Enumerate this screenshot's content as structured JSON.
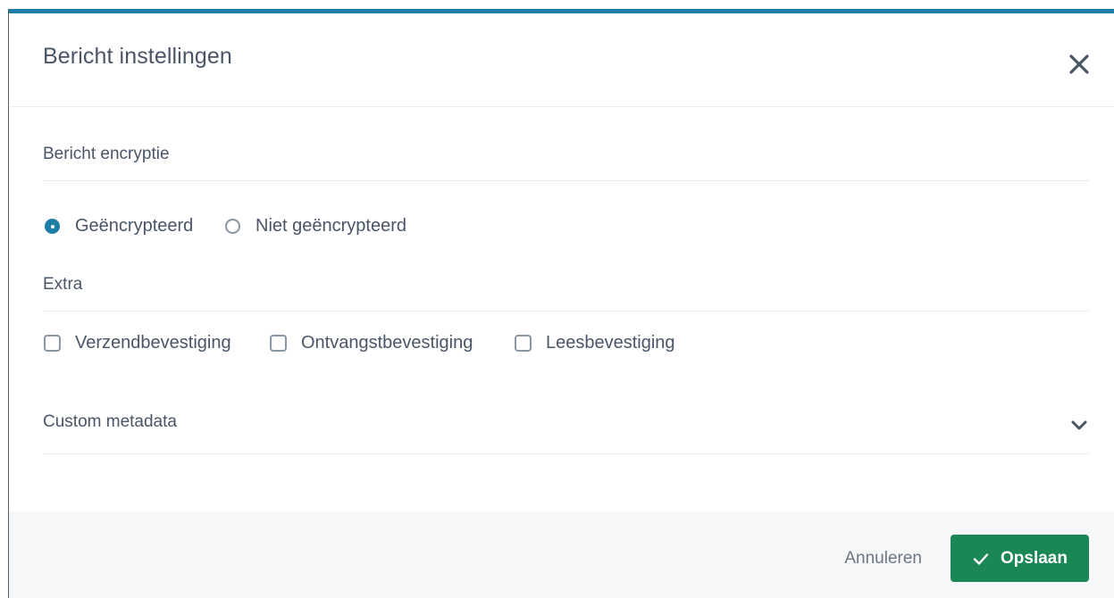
{
  "dialog": {
    "title": "Bericht instellingen",
    "close_icon": "close-icon",
    "accent_color": "#1f7ea5"
  },
  "encryption": {
    "label": "Bericht encryptie",
    "options": [
      {
        "label": "Geëncrypteerd",
        "checked": true
      },
      {
        "label": "Niet geëncrypteerd",
        "checked": false
      }
    ]
  },
  "extra": {
    "label": "Extra",
    "options": [
      {
        "label": "Verzendbevestiging",
        "checked": false
      },
      {
        "label": "Ontvangstbevestiging",
        "checked": false
      },
      {
        "label": "Leesbevestiging",
        "checked": false
      }
    ]
  },
  "metadata": {
    "label": "Custom metadata",
    "icon": "chevron-down-icon",
    "expanded": false
  },
  "footer": {
    "cancel_label": "Annuleren",
    "save_label": "Opslaan",
    "save_icon": "check-icon",
    "save_color": "#1a8754"
  }
}
